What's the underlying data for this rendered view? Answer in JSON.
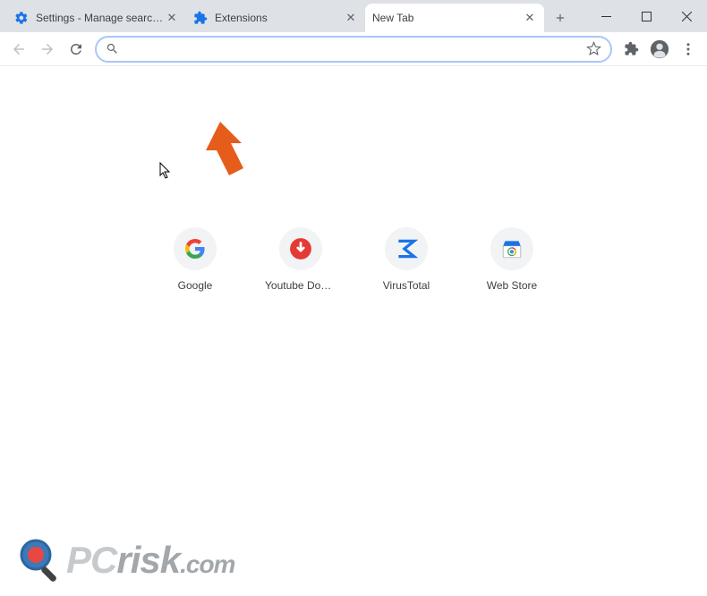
{
  "tabs": [
    {
      "label": "Settings - Manage search engin",
      "icon": "settings"
    },
    {
      "label": "Extensions",
      "icon": "extension"
    },
    {
      "label": "New Tab",
      "icon": "none",
      "active": true
    }
  ],
  "omnibox": {
    "value": "",
    "placeholder": ""
  },
  "shortcuts": [
    {
      "label": "Google",
      "icon": "google"
    },
    {
      "label": "Youtube Dow...",
      "icon": "download"
    },
    {
      "label": "VirusTotal",
      "icon": "virustotal"
    },
    {
      "label": "Web Store",
      "icon": "webstore"
    }
  ],
  "watermark": {
    "p": "P",
    "c": "C",
    "risk": "risk",
    "com": ".com"
  },
  "colors": {
    "accent_arrow": "#e65c1b",
    "tabbar": "#dee1e6",
    "omnibox_border": "#a8c7fa"
  }
}
